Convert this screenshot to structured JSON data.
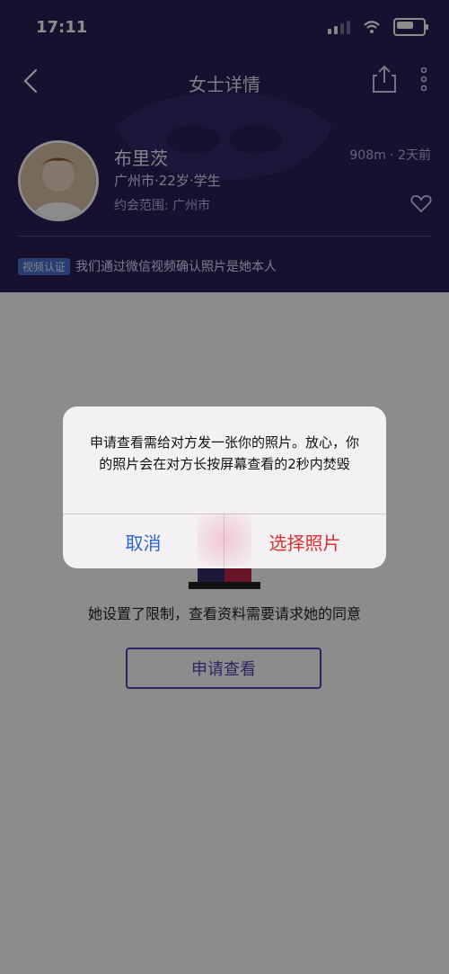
{
  "status": {
    "time": "17:11"
  },
  "nav": {
    "title": "女士详情"
  },
  "profile": {
    "name": "布里茨",
    "distance_time": "908m · 2天前",
    "meta": "广州市·22岁·学生",
    "range": "约会范围: 广州市",
    "verification_badge": "视频认证",
    "verification_text": "我们通过微信视频确认照片是她本人"
  },
  "main": {
    "restriction_text": "她设置了限制，查看资料需要请求她的同意",
    "request_button": "申请查看"
  },
  "alert": {
    "message": "申请查看需给对方发一张你的照片。放心，你的照片会在对方长按屏幕查看的2秒内焚毁",
    "cancel_label": "取消",
    "select_label": "选择照片"
  },
  "colors": {
    "header_bg": "#2b1f57",
    "primary": "#5b3fb2",
    "cancel_blue": "#2a64d6",
    "select_red": "#e12d2d"
  }
}
